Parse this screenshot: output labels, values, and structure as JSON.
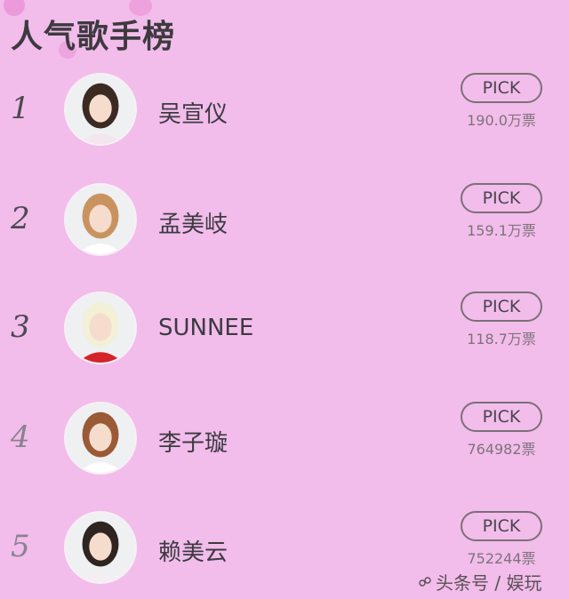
{
  "title": "人气歌手榜",
  "pick_label": "PICK",
  "watermark": "头条号 / 娱玩",
  "colors": {
    "background": "#f2bdea",
    "accent_circle": "#e98fd6",
    "text": "#3c3a42"
  },
  "rankings": [
    {
      "rank": "1",
      "name": "吴宣仪",
      "votes": "190.0万票",
      "hair": "#3b2a22",
      "shirt": "#f3e6ee"
    },
    {
      "rank": "2",
      "name": "孟美岐",
      "votes": "159.1万票",
      "hair": "#c9935f",
      "shirt": "#ffffff"
    },
    {
      "rank": "3",
      "name": "SUNNEE",
      "votes": "118.7万票",
      "hair": "#f2f0d6",
      "shirt": "#d4232b"
    },
    {
      "rank": "4",
      "name": "李子璇",
      "votes": "764982票",
      "hair": "#9a5a36",
      "shirt": "#ffffff"
    },
    {
      "rank": "5",
      "name": "赖美云",
      "votes": "752244票",
      "hair": "#2e2420",
      "shirt": "#f2eef2"
    }
  ]
}
